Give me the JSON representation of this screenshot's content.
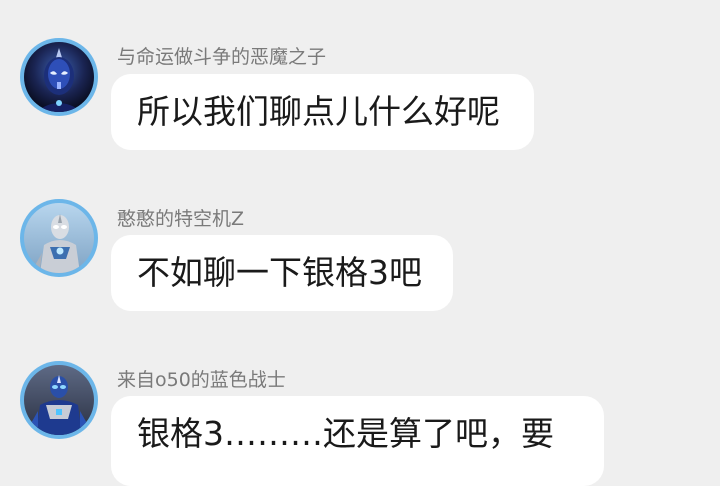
{
  "messages": [
    {
      "sender": "与命运做斗争的恶魔之子",
      "text": "所以我们聊点儿什么好呢",
      "avatar_icon": "dark-blue-hero-avatar-icon"
    },
    {
      "sender": "憨憨的特空机Z",
      "text": "不如聊一下银格3吧",
      "avatar_icon": "silver-hero-avatar-icon"
    },
    {
      "sender": "来自o50的蓝色战士",
      "text": "银格3………还是算了吧，要",
      "avatar_icon": "blue-armored-hero-avatar-icon"
    }
  ],
  "colors": {
    "background": "#efefef",
    "bubble": "#ffffff",
    "avatar_ring": "#6cb6e9",
    "sender_text": "#7a7a7a",
    "message_text": "#1a1a1a"
  }
}
